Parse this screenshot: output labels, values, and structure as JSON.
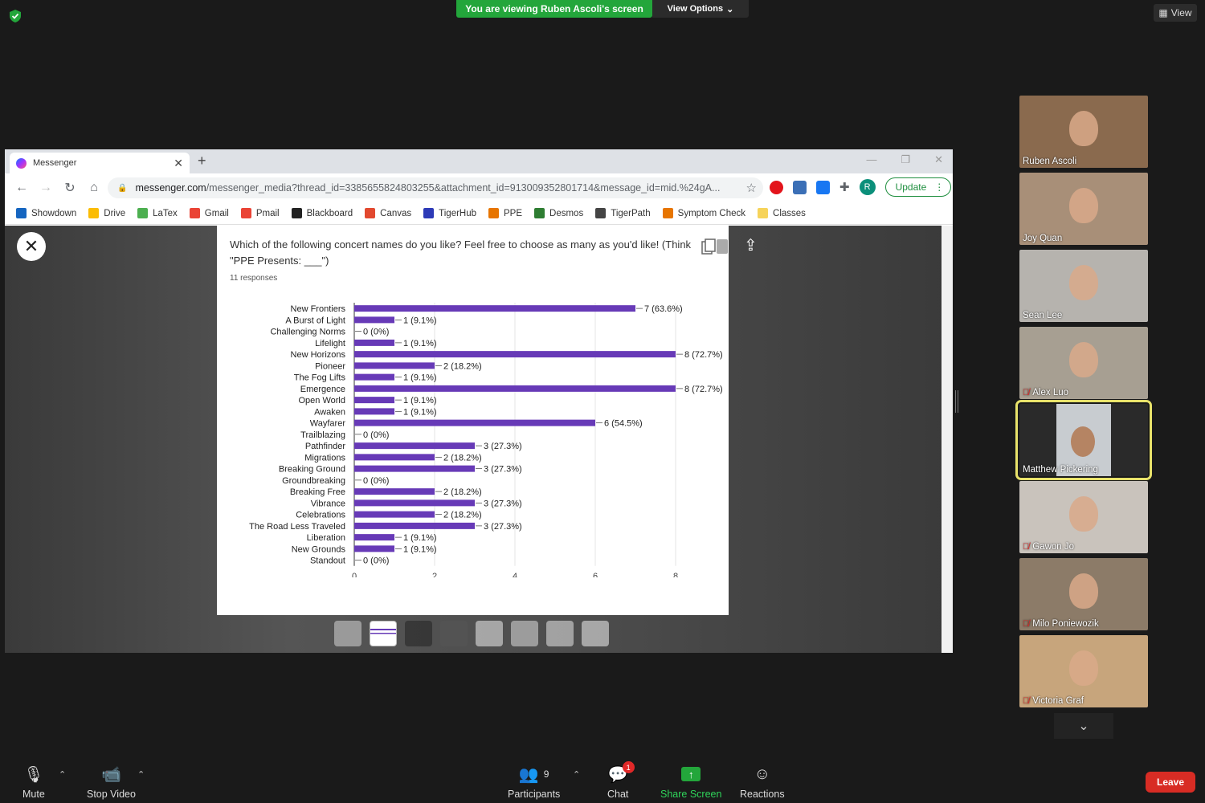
{
  "zoom": {
    "banner": "You are viewing Ruben Ascoli's screen",
    "view_options": "View Options",
    "view": "View"
  },
  "browser": {
    "tab_title": "Messenger",
    "url_host": "messenger.com",
    "url_path": "/messenger_media?thread_id=3385655824803255&attachment_id=913009352801714&message_id=mid.%24gA...",
    "profile_initial": "R",
    "update_label": "Update",
    "bookmarks": [
      {
        "label": "Showdown",
        "color": "#1565c0"
      },
      {
        "label": "Drive",
        "color": "#fbbc04"
      },
      {
        "label": "LaTex",
        "color": "#4caf50"
      },
      {
        "label": "Gmail",
        "color": "#ea4335"
      },
      {
        "label": "Pmail",
        "color": "#ea4335"
      },
      {
        "label": "Blackboard",
        "color": "#222222"
      },
      {
        "label": "Canvas",
        "color": "#e2492f"
      },
      {
        "label": "TigerHub",
        "color": "#2d3ab7"
      },
      {
        "label": "PPE",
        "color": "#e77500"
      },
      {
        "label": "Desmos",
        "color": "#2e7d32"
      },
      {
        "label": "TigerPath",
        "color": "#444444"
      },
      {
        "label": "Symptom Check",
        "color": "#e77500"
      },
      {
        "label": "Classes",
        "color": "#f6d35a"
      }
    ]
  },
  "form": {
    "question": "Which of the following concert names do you like? Feel free to choose as many as you'd like! (Think \"PPE Presents: ___\")",
    "responses": "11 responses"
  },
  "chart_data": {
    "type": "bar",
    "orientation": "horizontal",
    "title": "",
    "xlabel": "",
    "ylabel": "",
    "xlim": [
      0,
      8
    ],
    "xticks": [
      0,
      2,
      4,
      6,
      8
    ],
    "bar_color": "#673ab7",
    "categories": [
      "New Frontiers",
      "A Burst of Light",
      "Challenging Norms",
      "Lifelight",
      "New Horizons",
      "Pioneer",
      "The Fog Lifts",
      "Emergence",
      "Open World",
      "Awaken",
      "Wayfarer",
      "Trailblazing",
      "Pathfinder",
      "Migrations",
      "Breaking Ground",
      "Groundbreaking",
      "Breaking Free",
      "Vibrance",
      "Celebrations",
      "The Road Less Traveled",
      "Liberation",
      "New Grounds",
      "Standout"
    ],
    "values": [
      7,
      1,
      0,
      1,
      8,
      2,
      1,
      8,
      1,
      1,
      6,
      0,
      3,
      2,
      3,
      0,
      2,
      3,
      2,
      3,
      1,
      1,
      0
    ],
    "data_labels": [
      "7 (63.6%)",
      "1 (9.1%)",
      "0 (0%)",
      "1 (9.1%)",
      "8 (72.7%)",
      "2 (18.2%)",
      "1 (9.1%)",
      "8 (72.7%)",
      "1 (9.1%)",
      "1 (9.1%)",
      "6 (54.5%)",
      "0 (0%)",
      "3 (27.3%)",
      "2 (18.2%)",
      "3 (27.3%)",
      "0 (0%)",
      "2 (18.2%)",
      "3 (27.3%)",
      "2 (18.2%)",
      "3 (27.3%)",
      "1 (9.1%)",
      "1 (9.1%)",
      "0 (0%)"
    ]
  },
  "participants": [
    {
      "name": "Ruben Ascoli",
      "muted": false,
      "bg": "#8a6a4e"
    },
    {
      "name": "Joy Quan",
      "muted": false,
      "bg": "#a88f78"
    },
    {
      "name": "Sean Lee",
      "muted": false,
      "bg": "#b6b3ae"
    },
    {
      "name": "Alex Luo",
      "muted": true,
      "bg": "#a79f92"
    },
    {
      "name": "Matthew Pickering",
      "muted": false,
      "bg": "#2a2a2a"
    },
    {
      "name": "Gawon Jo",
      "muted": true,
      "bg": "#c9c3bc"
    },
    {
      "name": "Milo Poniewozik",
      "muted": true,
      "bg": "#8c7b68"
    },
    {
      "name": "Victoria Graf",
      "muted": true,
      "bg": "#c7a57c"
    }
  ],
  "toolbar": {
    "mute": "Mute",
    "stop_video": "Stop Video",
    "participants": "Participants",
    "participant_count": "9",
    "chat": "Chat",
    "chat_badge": "1",
    "share_screen": "Share Screen",
    "reactions": "Reactions",
    "leave": "Leave"
  },
  "colors": {
    "share_green": "#23a63b",
    "leave_red": "#d82c24",
    "active_speaker": "#e8e26a"
  }
}
